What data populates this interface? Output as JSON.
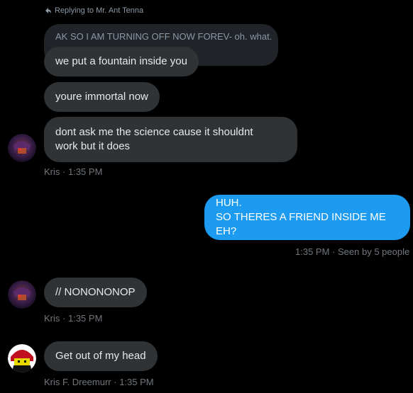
{
  "reply_context": {
    "text": "Replying to Mr. Ant Tenna"
  },
  "quoted_message": {
    "text": "AK SO I AM TURNING OFF NOW FOREV- oh. what."
  },
  "messages": [
    {
      "text": "we put a fountain inside you"
    },
    {
      "text": "youre immortal now"
    },
    {
      "lines": [
        "dont ask me the science cause it shouldnt",
        "work but it does"
      ],
      "sender": "Kris",
      "time": "1:35 PM"
    },
    {
      "lines": [
        "HUH.",
        "SO THERES A FRIEND INSIDE ME EH?"
      ],
      "time": "1:35 PM",
      "seen": "Seen by 5 people"
    },
    {
      "text": "// NONONONOP",
      "sender": "Kris",
      "time": "1:35 PM"
    },
    {
      "text": "Get out of my head",
      "sender": "Kris F. Dreemurr",
      "time": "1:35 PM"
    }
  ],
  "separator": "·",
  "colors": {
    "outgoing_bubble": "#1d9bf0",
    "incoming_bubble": "#2f3336",
    "meta_text": "#71767b",
    "background": "#000000"
  }
}
